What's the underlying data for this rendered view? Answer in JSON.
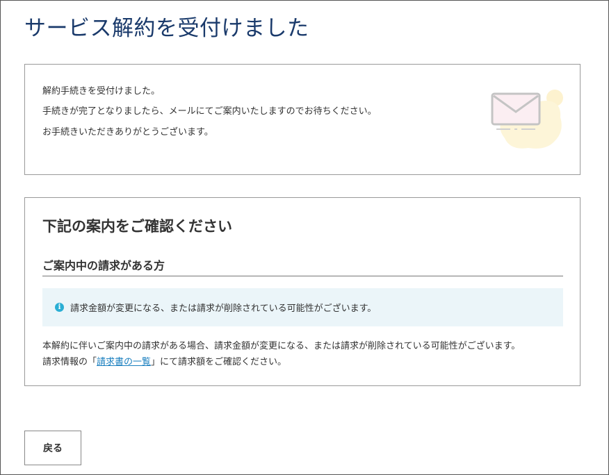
{
  "page": {
    "title": "サービス解約を受付けました"
  },
  "completion_card": {
    "line1": "解約手続きを受付けました。",
    "line2": "手続きが完了となりましたら、メールにてご案内いたしますのでお待ちください。",
    "line3": "お手続きいただきありがとうございます。",
    "illustration_icon": "envelope-icon"
  },
  "guide_card": {
    "heading": "下記の案内をご確認ください",
    "subheading": "ご案内中の請求がある方",
    "notice": {
      "icon": "info-icon",
      "icon_glyph": "i",
      "text": "請求金額が変更になる、または請求が削除されている可能性がございます。"
    },
    "body_line1": "本解約に伴いご案内中の請求がある場合、請求金額が変更になる、または請求が削除されている可能性がございます。",
    "body_line2_prefix": "請求情報の「",
    "body_line2_link": "請求書の一覧",
    "body_line2_suffix": "」にて請求額をご確認ください。"
  },
  "actions": {
    "back_label": "戻る"
  },
  "colors": {
    "title": "#1a3a6b",
    "link": "#1a7fbf",
    "info_icon": "#2aaed4",
    "notice_bg": "#ebf5f9"
  }
}
